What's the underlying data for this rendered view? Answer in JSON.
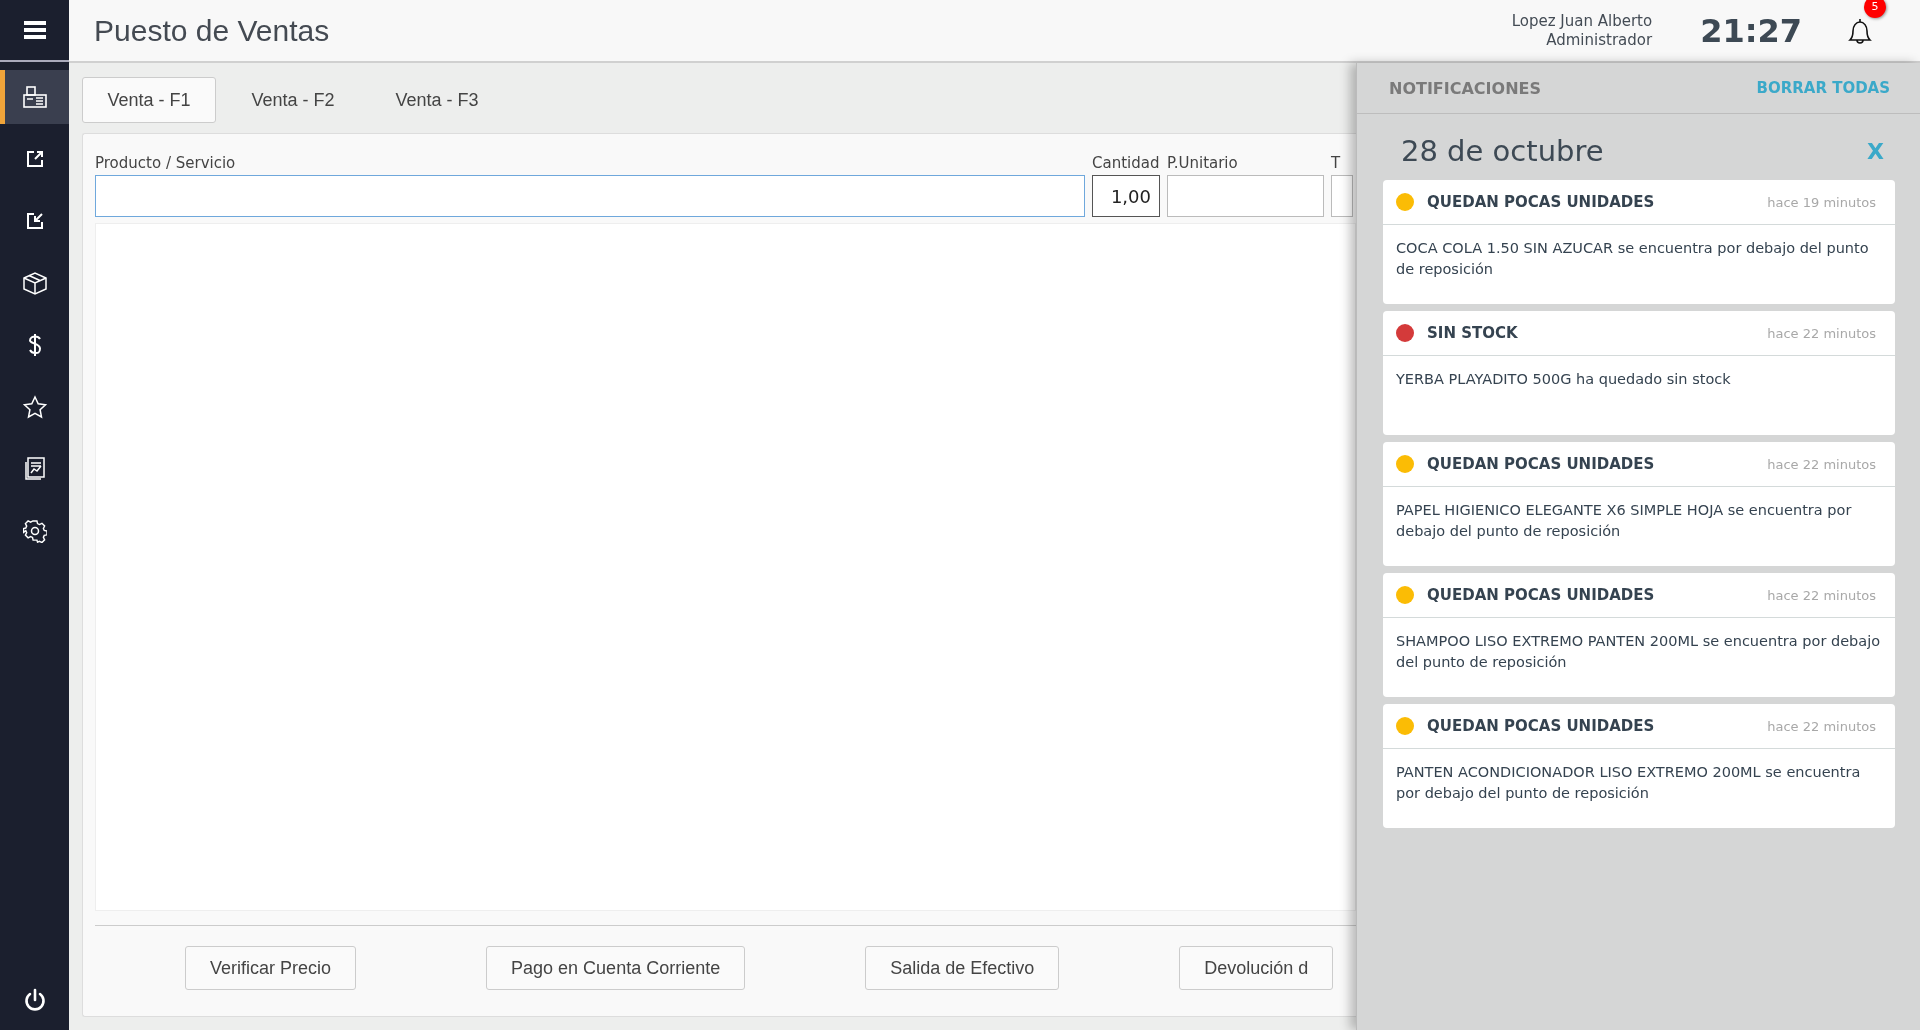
{
  "sidebar": {
    "items": [
      {
        "selected": true
      },
      {
        "selected": false
      },
      {
        "selected": false
      },
      {
        "selected": false
      },
      {
        "selected": false
      },
      {
        "selected": false
      },
      {
        "selected": false
      },
      {
        "selected": false
      }
    ]
  },
  "header": {
    "title": "Puesto de Ventas",
    "user_name": "Lopez Juan Alberto",
    "user_role": "Administrador",
    "time": "21:27",
    "notification_count": "5"
  },
  "tabs": [
    {
      "label": "Venta - F1",
      "selected": true
    },
    {
      "label": "Venta - F2",
      "selected": false
    },
    {
      "label": "Venta - F3",
      "selected": false
    }
  ],
  "form": {
    "fields": [
      {
        "kind": "product",
        "label": "Producto / Servicio"
      },
      {
        "kind": "quantity",
        "label": "Cantidad",
        "value": "1,00"
      },
      {
        "kind": "price",
        "label": "P.Unitario"
      },
      {
        "kind": "cut",
        "label": "T"
      }
    ]
  },
  "buttons": [
    "Verificar Precio",
    "Pago en Cuenta Corriente",
    "Salida de Efectivo",
    "Devolución d"
  ],
  "notifications": {
    "title": "NOTIFICACIONES",
    "clear_all": "BORRAR TODAS",
    "date": "28 de octubre",
    "close": "X",
    "items": [
      {
        "title": "QUEDAN POCAS UNIDADES",
        "time": "hace 19 minutos",
        "color": "#fbbc05",
        "message": "COCA COLA 1.50 SIN AZUCAR se encuentra por debajo del punto de reposición"
      },
      {
        "title": "SIN STOCK",
        "time": "hace 22 minutos",
        "color": "#d43a3a",
        "message": "YERBA PLAYADITO 500G ha quedado sin stock"
      },
      {
        "title": "QUEDAN POCAS UNIDADES",
        "time": "hace 22 minutos",
        "color": "#fbbc05",
        "message": "PAPEL HIGIENICO ELEGANTE X6 SIMPLE HOJA se encuentra por debajo del punto de reposición"
      },
      {
        "title": "QUEDAN POCAS UNIDADES",
        "time": "hace 22 minutos",
        "color": "#fbbc05",
        "message": "SHAMPOO LISO EXTREMO PANTEN 200ML se encuentra por debajo del punto de reposición"
      },
      {
        "title": "QUEDAN POCAS UNIDADES",
        "time": "hace 22 minutos",
        "color": "#fbbc05",
        "message": "PANTEN ACONDICIONADOR LISO EXTREMO 200ML se encuentra por debajo del punto de reposición"
      }
    ]
  }
}
